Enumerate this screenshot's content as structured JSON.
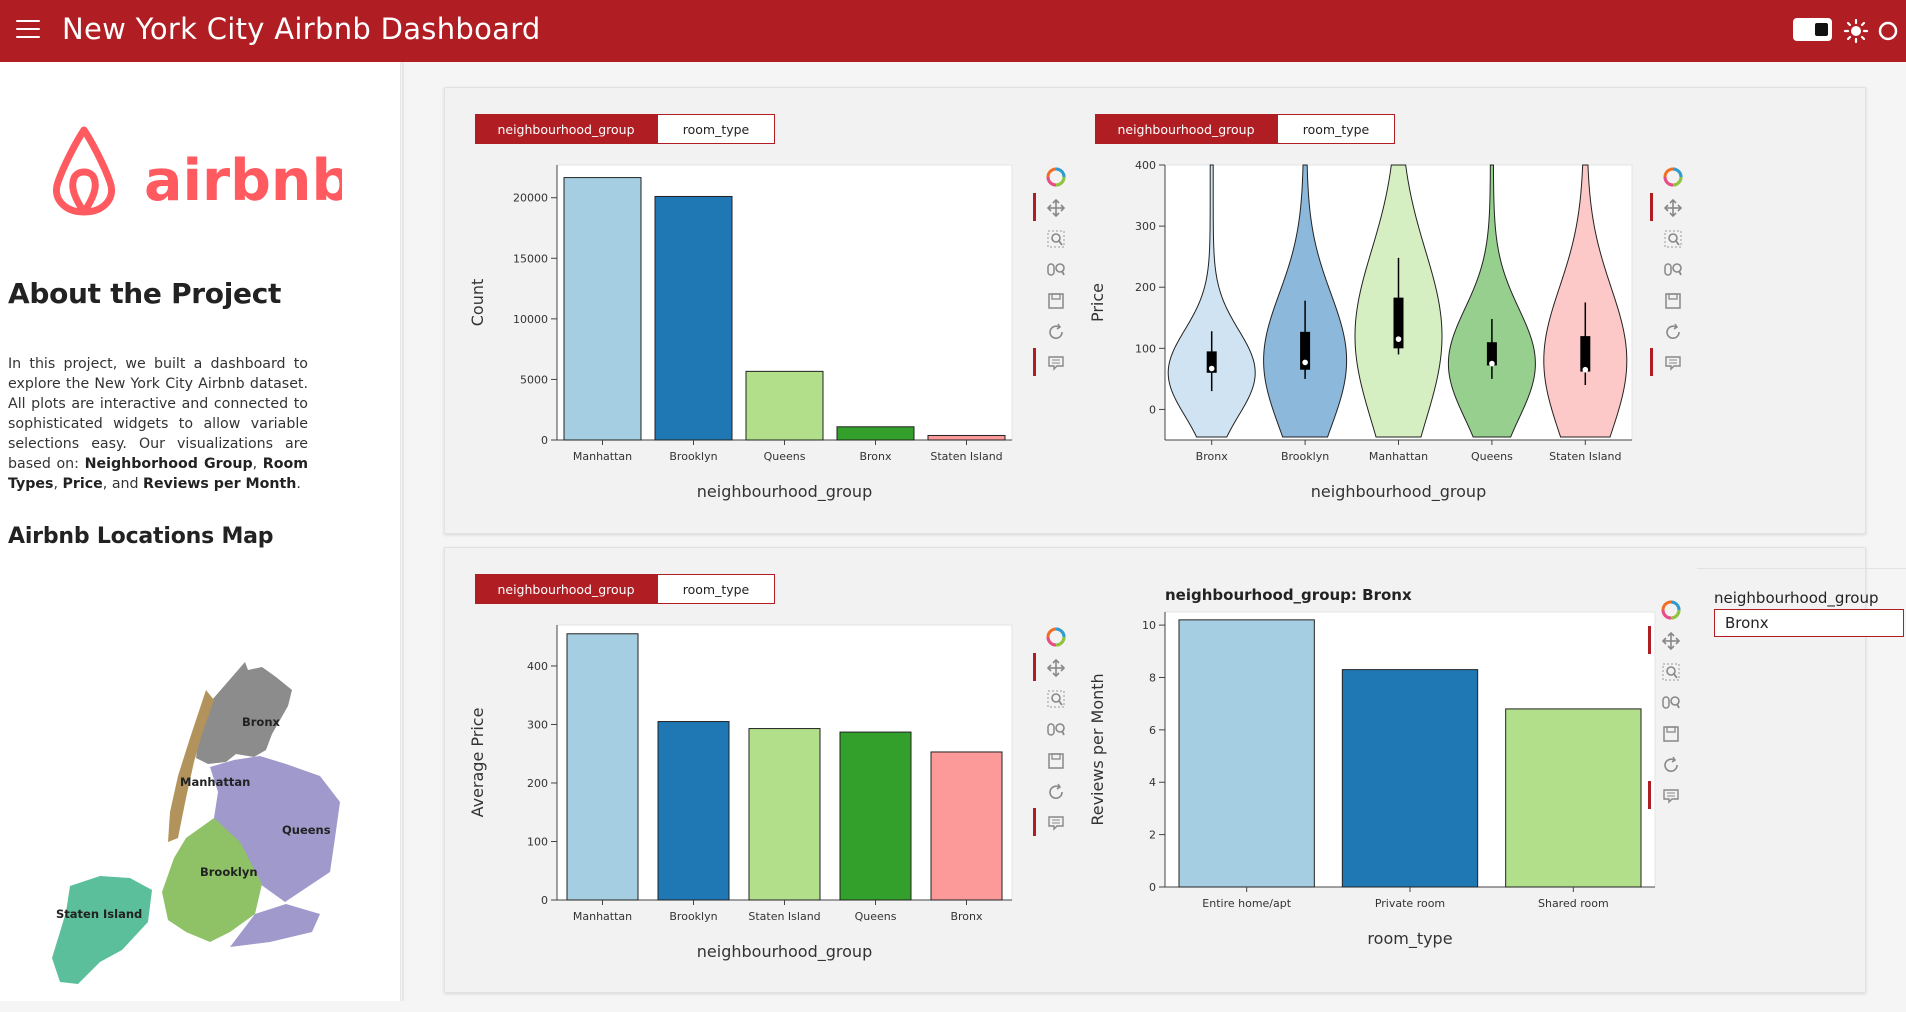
{
  "header": {
    "title": "New York City Airbnb Dashboard",
    "bg_color": "#b01e23"
  },
  "sidebar": {
    "logo_text": "airbnb",
    "about_title": "About the Project",
    "about_intro": "In this project, we built a dashboard to explore the New York City Airbnb dataset. All plots are interactive and connected to sophisticated widgets to allow variable selections easy. Our visualizations are based on: ",
    "about_terms": [
      "Neighborhood Group",
      "Room Types",
      "Price",
      "Reviews per Month"
    ],
    "about_sep1": ", ",
    "about_sep2": ", ",
    "about_sep3": ", and ",
    "about_end": ".",
    "map_title": "Airbnb Locations Map",
    "map_labels": [
      "Bronx",
      "Manhattan",
      "Queens",
      "Brooklyn",
      "Staten Island"
    ]
  },
  "tabs": [
    "neighbourhood_group",
    "room_type"
  ],
  "toolbar_icons": [
    "bokeh-logo-icon",
    "pan-icon",
    "box-zoom-icon",
    "wheel-zoom-icon",
    "save-icon",
    "reset-icon",
    "hover-icon"
  ],
  "widget": {
    "label": "neighbourhood_group",
    "value": "Bronx"
  },
  "colors": {
    "accent": "#b01e23",
    "palette": [
      "#a6cee3",
      "#1f78b4",
      "#b2df8a",
      "#33a02c",
      "#fb9a99"
    ]
  },
  "chart_data": [
    {
      "type": "bar",
      "categories": [
        "Manhattan",
        "Brooklyn",
        "Queens",
        "Bronx",
        "Staten Island"
      ],
      "values": [
        21661,
        20104,
        5666,
        1091,
        373
      ],
      "xlabel": "neighbourhood_group",
      "ylabel": "Count",
      "ylim": [
        0,
        22700
      ],
      "yticks": [
        0,
        5000,
        10000,
        15000,
        20000
      ],
      "colors": [
        "#a6cee3",
        "#1f78b4",
        "#b2df8a",
        "#33a02c",
        "#fb9a99"
      ]
    },
    {
      "type": "violin",
      "categories": [
        "Bronx",
        "Brooklyn",
        "Manhattan",
        "Queens",
        "Staten Island"
      ],
      "xlabel": "neighbourhood_group",
      "ylabel": "Price",
      "ylim": [
        -50,
        400
      ],
      "yticks": [
        0,
        100,
        200,
        300,
        400
      ],
      "boxes": [
        {
          "q1": 60,
          "median": 67,
          "q3": 95,
          "whisker_low": 30,
          "whisker_high": 128
        },
        {
          "q1": 65,
          "median": 77,
          "q3": 127,
          "whisker_low": 50,
          "whisker_high": 178
        },
        {
          "q1": 100,
          "median": 115,
          "q3": 183,
          "whisker_low": 90,
          "whisker_high": 248
        },
        {
          "q1": 72,
          "median": 75,
          "q3": 110,
          "whisker_low": 50,
          "whisker_high": 148
        },
        {
          "q1": 62,
          "median": 65,
          "q3": 120,
          "whisker_low": 40,
          "whisker_high": 175
        }
      ],
      "colors": [
        "#cfe3f2",
        "#8cb8dc",
        "#d6efc2",
        "#97cf8e",
        "#fdc8c8"
      ]
    },
    {
      "type": "bar",
      "categories": [
        "Manhattan",
        "Brooklyn",
        "Staten Island",
        "Queens",
        "Bronx"
      ],
      "values": [
        455,
        305,
        293,
        287,
        253
      ],
      "xlabel": "neighbourhood_group",
      "ylabel": "Average Price",
      "ylim": [
        0,
        470
      ],
      "yticks": [
        0,
        100,
        200,
        300,
        400
      ],
      "colors": [
        "#a6cee3",
        "#1f78b4",
        "#b2df8a",
        "#33a02c",
        "#fb9a99"
      ]
    },
    {
      "type": "bar",
      "title": "neighbourhood_group: Bronx",
      "categories": [
        "Entire home/apt",
        "Private room",
        "Shared room"
      ],
      "values": [
        10.2,
        8.3,
        6.8
      ],
      "xlabel": "room_type",
      "ylabel": "Reviews per Month",
      "ylim": [
        0,
        10.5
      ],
      "yticks": [
        0,
        2,
        4,
        6,
        8,
        10
      ],
      "colors": [
        "#a6cee3",
        "#1f78b4",
        "#b2df8a"
      ]
    }
  ]
}
